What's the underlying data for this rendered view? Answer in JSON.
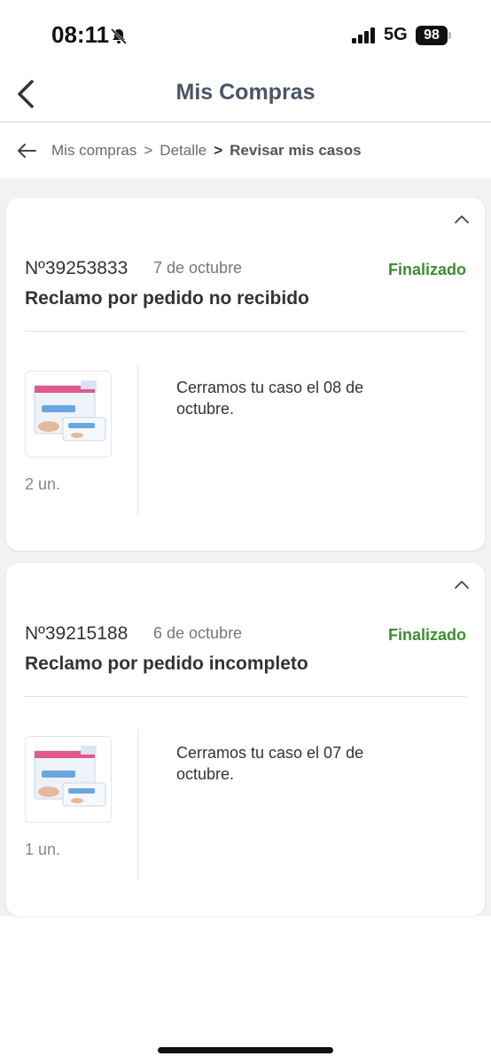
{
  "status_bar": {
    "time": "08:11",
    "network": "5G",
    "battery": "98"
  },
  "header": {
    "title": "Mis Compras"
  },
  "breadcrumb": {
    "items": [
      "Mis compras",
      "Detalle"
    ],
    "current": "Revisar mis casos"
  },
  "cases": [
    {
      "number": "Nº39253833",
      "date": "7 de octubre",
      "status": "Finalizado",
      "title": "Reclamo por pedido no recibido",
      "quantity": "2 un.",
      "message": "Cerramos tu caso el 08 de octubre."
    },
    {
      "number": "Nº39215188",
      "date": "6 de octubre",
      "status": "Finalizado",
      "title": "Reclamo por pedido incompleto",
      "quantity": "1 un.",
      "message": "Cerramos tu caso el 07 de octubre."
    }
  ],
  "colors": {
    "status_finalizado": "#3a8f2f",
    "header_title": "#4a5566",
    "content_background": "#f2f2f2"
  },
  "icons": {
    "back": "chevron-left-icon",
    "breadcrumb_back": "arrow-left-icon",
    "collapse": "chevron-up-icon",
    "muted": "bell-slash-icon"
  }
}
